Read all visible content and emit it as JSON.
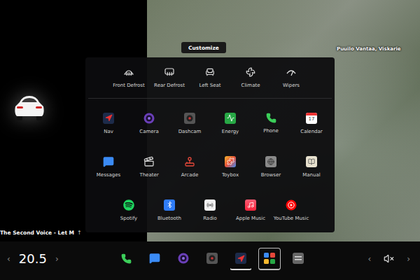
{
  "customize": {
    "label": "Customize"
  },
  "map": {
    "label": "Puuilo Vantaa, Viskarie"
  },
  "quick_controls": [
    {
      "label": "Front Defrost",
      "kind": "front-defrost"
    },
    {
      "label": "Rear Defrost",
      "kind": "rear-defrost"
    },
    {
      "label": "Left Seat",
      "kind": "seat"
    },
    {
      "label": "Climate",
      "kind": "fan"
    },
    {
      "label": "Wipers",
      "kind": "wipers"
    }
  ],
  "app_rows": [
    [
      {
        "label": "Nav",
        "kind": "nav"
      },
      {
        "label": "Camera",
        "kind": "camera"
      },
      {
        "label": "Dashcam",
        "kind": "dashcam"
      },
      {
        "label": "Energy",
        "kind": "energy"
      },
      {
        "label": "Phone",
        "kind": "phone"
      },
      {
        "label": "Calendar",
        "kind": "calendar",
        "date": "17"
      }
    ],
    [
      {
        "label": "Messages",
        "kind": "messages"
      },
      {
        "label": "Theater",
        "kind": "theater"
      },
      {
        "label": "Arcade",
        "kind": "arcade"
      },
      {
        "label": "Toybox",
        "kind": "toybox"
      },
      {
        "label": "Browser",
        "kind": "browser"
      },
      {
        "label": "Manual",
        "kind": "manual"
      }
    ],
    [
      {
        "label": "Spotify",
        "kind": "spotify"
      },
      {
        "label": "Bluetooth",
        "kind": "bluetooth"
      },
      {
        "label": "Radio",
        "kind": "radio"
      },
      {
        "label": "Apple Music",
        "kind": "apple-music"
      },
      {
        "label": "YouTube Music",
        "kind": "youtube-music"
      }
    ]
  ],
  "media": {
    "title": "The Second Voice - Let M",
    "expand": "↑"
  },
  "climate": {
    "temperature": "20.5",
    "decrease": "‹",
    "increase": "›"
  },
  "dock": [
    {
      "kind": "phone",
      "selected": false,
      "open": false
    },
    {
      "kind": "messages",
      "selected": false,
      "open": false
    },
    {
      "kind": "camera",
      "selected": false,
      "open": false
    },
    {
      "kind": "dashcam",
      "selected": false,
      "open": false
    },
    {
      "kind": "nav",
      "selected": false,
      "open": true
    },
    {
      "kind": "apps",
      "selected": true,
      "open": false
    },
    {
      "kind": "more",
      "selected": false,
      "open": false
    }
  ],
  "volume": {
    "muted": true,
    "decrease": "‹",
    "increase": "›"
  }
}
